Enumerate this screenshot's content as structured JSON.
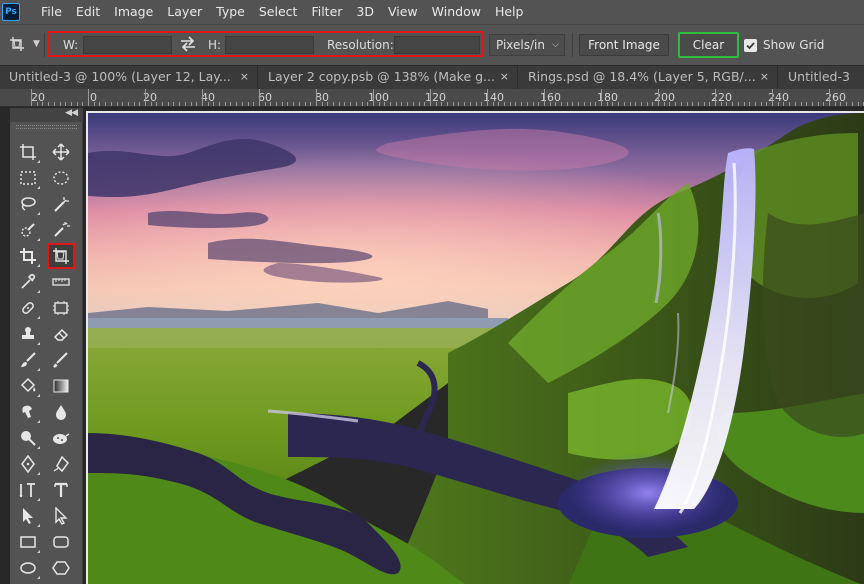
{
  "app": {
    "logo": "Ps"
  },
  "menu": [
    "File",
    "Edit",
    "Image",
    "Layer",
    "Type",
    "Select",
    "Filter",
    "3D",
    "View",
    "Window",
    "Help"
  ],
  "options": {
    "width_label": "W:",
    "height_label": "H:",
    "resolution_label": "Resolution:",
    "width_value": "",
    "height_value": "",
    "resolution_value": "",
    "units": "Pixels/in",
    "front_image_label": "Front Image",
    "clear_label": "Clear",
    "show_grid_label": "Show Grid",
    "show_grid_checked": true
  },
  "tabs": [
    {
      "label": "Untitled-3 @ 100% (Layer 12, Lay...",
      "close": "×"
    },
    {
      "label": "Layer 2 copy.psb @ 138% (Make g...",
      "close": "×"
    },
    {
      "label": "Rings.psd @ 18.4% (Layer 5, RGB/...",
      "close": "×"
    },
    {
      "label": "Untitled-3",
      "close": ""
    }
  ],
  "ruler": [
    "20",
    "0",
    "20",
    "40",
    "60",
    "80",
    "100",
    "120",
    "140",
    "160",
    "180",
    "200",
    "220",
    "240",
    "260"
  ],
  "tools": {
    "selected": "perspective-crop-tool",
    "list": [
      "artboard-tool",
      "move-tool",
      "rectangular-marquee-tool",
      "elliptical-marquee-tool",
      "lasso-tool",
      "magic-wand-tool",
      "quick-selection-tool",
      "magic-eraser-tool",
      "crop-tool",
      "perspective-crop-tool",
      "eyedropper-tool",
      "ruler-tool",
      "healing-brush-tool",
      "patch-tool",
      "clone-stamp-tool",
      "eraser-tool",
      "brush-tool",
      "pencil-tool",
      "paint-bucket-tool",
      "gradient-tool",
      "smudge-tool",
      "blur-tool",
      "dodge-tool",
      "sponge-tool",
      "pen-tool",
      "freeform-pen-tool",
      "vertical-type-tool",
      "horizontal-type-tool",
      "path-selection-tool",
      "direct-selection-tool",
      "rectangle-tool",
      "rounded-rectangle-tool",
      "ellipse-tool",
      "polygon-tool"
    ]
  },
  "colors": {
    "highlight_red": "#e0161b",
    "highlight_green": "#2fbd3b",
    "ui_bg": "#535353"
  }
}
